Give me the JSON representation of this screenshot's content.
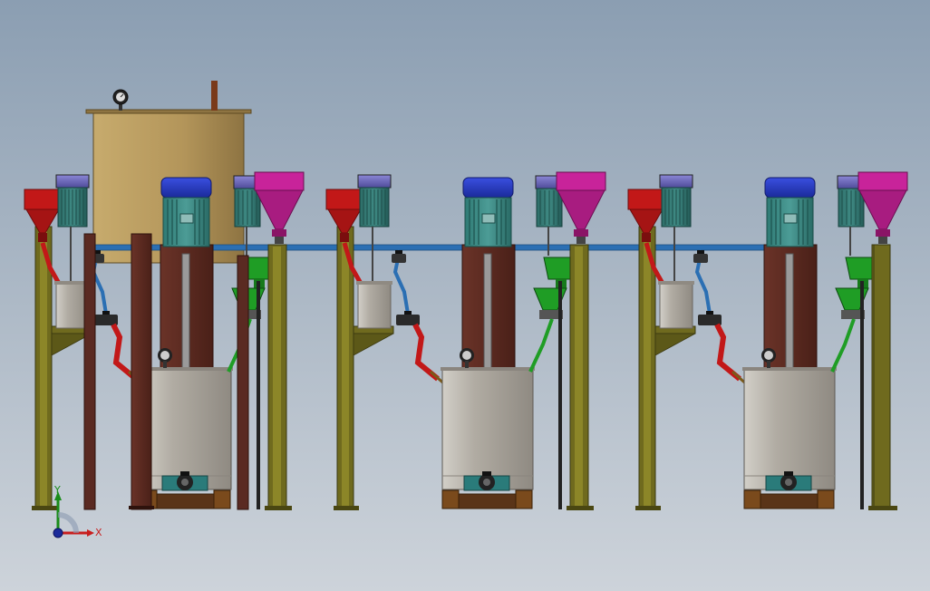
{
  "triad": {
    "y_label": "Y",
    "x_label": "X"
  },
  "colors": {
    "background_top": "#8b9eb2",
    "background_bottom": "#cdd3da",
    "frame_olive": "#6f6a1e",
    "tank_stainless": "#b1aca3",
    "storage_tank": "#b99a5b",
    "motor_blue": "#2337c8",
    "motor_body": "#3d8a84",
    "hopper_red": "#c21818",
    "hopper_magenta": "#c8239a",
    "hopper_green": "#1f9d25",
    "pipe_blue": "#2b6fb3",
    "column_brown": "#5a2a22"
  },
  "icons": [
    "coordinate-triad-icon",
    "gauge-icon",
    "valve-icon"
  ]
}
